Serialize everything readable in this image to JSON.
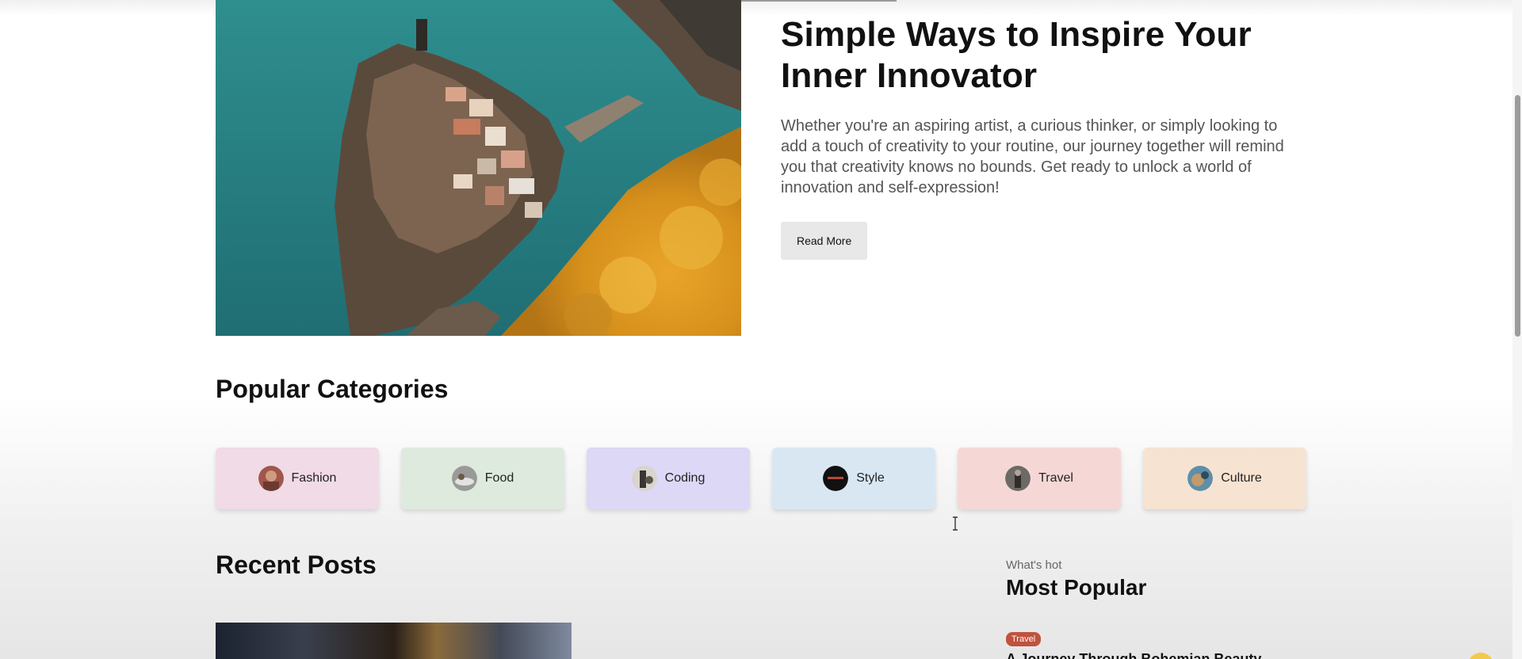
{
  "hero": {
    "title": "Simple Ways to Inspire Your Inner Innovator",
    "description": "Whether you're an aspiring artist, a curious thinker, or simply looking to add a touch of creativity to your routine, our journey together will remind you that creativity knows no bounds. Get ready to unlock a world of innovation and self-expression!",
    "read_more_label": "Read More"
  },
  "categories": {
    "title": "Popular Categories",
    "items": [
      {
        "label": "Fashion",
        "bg": "#f0dbe6"
      },
      {
        "label": "Food",
        "bg": "#dfeadf"
      },
      {
        "label": "Coding",
        "bg": "#dcd8f6"
      },
      {
        "label": "Style",
        "bg": "#d9e7f3"
      },
      {
        "label": "Travel",
        "bg": "#f5d8d6"
      },
      {
        "label": "Culture",
        "bg": "#f7e3d2"
      }
    ]
  },
  "recent_posts": {
    "title": "Recent Posts"
  },
  "sidebar": {
    "hot_label": "What's hot",
    "title": "Most Popular",
    "first_post": {
      "category": "Travel",
      "title": "A Journey Through Bohemian Beauty"
    }
  },
  "colors": {
    "travel_tag": "#c0523f",
    "read_more_bg": "#e8e8e8"
  }
}
